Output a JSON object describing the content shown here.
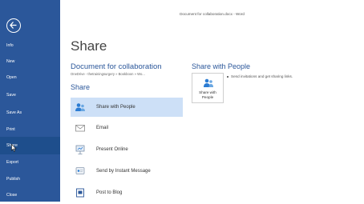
{
  "titlebar": {
    "text": "Document for collaboration.docx  -  Word"
  },
  "sidebar": {
    "items": [
      {
        "label": "Info"
      },
      {
        "label": "New"
      },
      {
        "label": "Open"
      },
      {
        "label": "Save"
      },
      {
        "label": "Save As"
      },
      {
        "label": "Print"
      },
      {
        "label": "Share"
      },
      {
        "label": "Export"
      },
      {
        "label": "Publish"
      },
      {
        "label": "Close"
      }
    ],
    "active_label": "Share"
  },
  "main": {
    "title": "Share",
    "document_name": "Document for collaboration",
    "document_path": "OneDrive - thetrainingsurgery » Bookboon » Wo...",
    "share_heading": "Share",
    "options": [
      {
        "label": "Share with People",
        "icon": "people-icon"
      },
      {
        "label": "Email",
        "icon": "email-icon"
      },
      {
        "label": "Present Online",
        "icon": "present-icon"
      },
      {
        "label": "Send by Instant Message",
        "icon": "instant-message-icon"
      },
      {
        "label": "Post to Blog",
        "icon": "blog-icon"
      }
    ],
    "selected_option": "Share with People"
  },
  "panel": {
    "heading": "Share with People",
    "tile_label_line1": "Share with",
    "tile_label_line2": "People",
    "description": "Send invitations and get sharing links."
  },
  "colors": {
    "accent": "#2b579a",
    "selected": "#cde0f7"
  }
}
